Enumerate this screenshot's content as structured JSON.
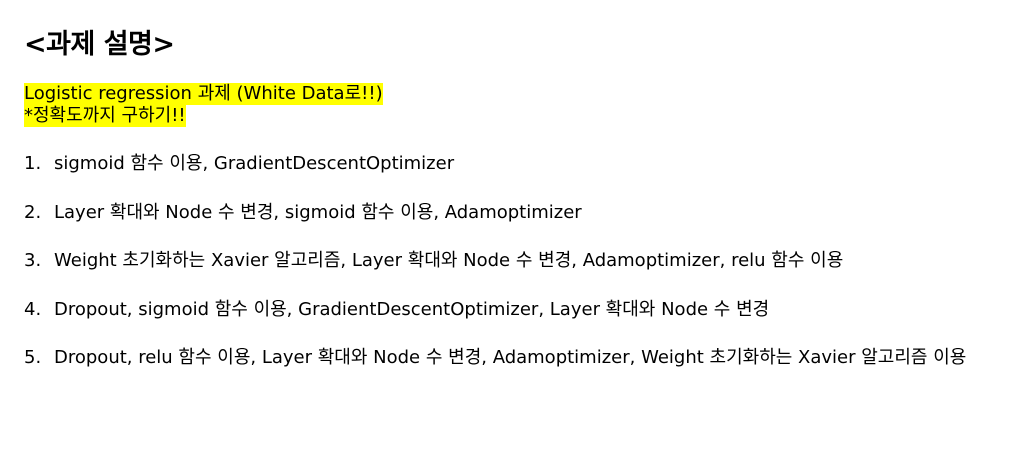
{
  "title": "<과제 설명>",
  "highlight": {
    "line1": "Logistic regression 과제 (White Data로!!)",
    "line2": "*정확도까지 구하기!!"
  },
  "tasks": [
    {
      "num": "1.",
      "text": "sigmoid 함수 이용, GradientDescentOptimizer"
    },
    {
      "num": "2.",
      "text": "Layer 확대와 Node 수 변경, sigmoid 함수 이용, Adamoptimizer"
    },
    {
      "num": "3.",
      "text": "Weight 초기화하는 Xavier 알고리즘, Layer 확대와 Node 수 변경, Adamoptimizer, relu 함수 이용"
    },
    {
      "num": "4.",
      "text": "Dropout, sigmoid 함수 이용, GradientDescentOptimizer, Layer 확대와 Node 수 변경"
    },
    {
      "num": "5.",
      "text": "Dropout, relu 함수 이용, Layer 확대와 Node 수 변경, Adamoptimizer, Weight 초기화하는 Xavier 알고리즘 이용"
    }
  ],
  "colors": {
    "highlight": "#ffff00",
    "text": "#000000",
    "background": "#ffffff"
  }
}
